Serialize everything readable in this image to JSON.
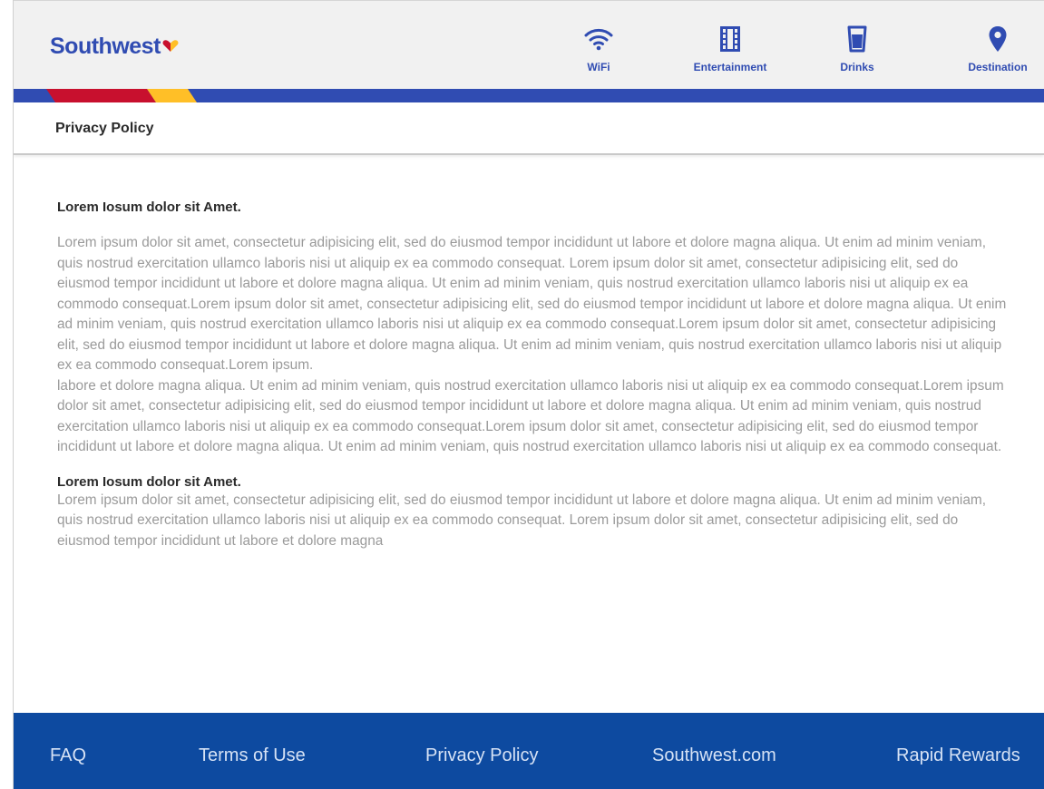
{
  "header": {
    "brand": "Southwest",
    "nav": [
      {
        "label": "WiFi",
        "icon": "wifi-icon"
      },
      {
        "label": "Entertainment",
        "icon": "film-icon"
      },
      {
        "label": "Drinks",
        "icon": "drink-icon"
      },
      {
        "label": "Destination",
        "icon": "map-pin-icon"
      }
    ],
    "colors": {
      "brand_blue": "#304cb2",
      "stripe_red": "#c8102e",
      "stripe_yellow": "#ffbf27"
    }
  },
  "page": {
    "title": "Privacy Policy"
  },
  "content": {
    "section1": {
      "heading": "Lorem Iosum dolor sit Amet.",
      "paragraph1": "Lorem ipsum dolor sit amet, consectetur adipisicing elit, sed do eiusmod tempor incididunt ut labore et dolore magna aliqua. Ut enim ad minim veniam, quis nostrud exercitation ullamco laboris nisi ut aliquip ex ea commodo consequat. Lorem ipsum dolor sit amet, consectetur adipisicing elit, sed do eiusmod tempor incididunt ut labore et dolore magna aliqua. Ut enim ad minim veniam, quis nostrud exercitation ullamco laboris nisi ut aliquip ex ea commodo consequat.Lorem ipsum dolor sit amet, consectetur adipisicing elit, sed do eiusmod tempor incididunt ut labore et dolore magna aliqua. Ut enim ad minim veniam, quis nostrud exercitation ullamco laboris nisi ut aliquip ex ea commodo consequat.Lorem ipsum dolor sit amet, consectetur adipisicing elit, sed do eiusmod tempor incididunt ut labore et dolore magna aliqua. Ut enim ad minim veniam, quis nostrud exercitation ullamco laboris nisi ut aliquip ex ea commodo consequat.Lorem ipsum.",
      "paragraph2": "labore et dolore magna aliqua. Ut enim ad minim veniam, quis nostrud exercitation ullamco laboris nisi ut aliquip ex ea commodo consequat.Lorem ipsum dolor sit amet, consectetur adipisicing elit, sed do eiusmod tempor incididunt ut labore et dolore magna aliqua. Ut enim ad minim veniam, quis nostrud exercitation ullamco laboris nisi ut aliquip ex ea commodo consequat.Lorem ipsum dolor sit amet, consectetur adipisicing elit, sed do eiusmod tempor incididunt ut labore et dolore magna aliqua. Ut enim ad minim veniam, quis nostrud exercitation ullamco laboris nisi ut aliquip ex ea commodo consequat."
    },
    "section2": {
      "heading": "Lorem Iosum dolor sit Amet.",
      "paragraph": "Lorem ipsum dolor sit amet, consectetur adipisicing elit, sed do eiusmod tempor incididunt ut labore et dolore magna aliqua. Ut enim ad minim veniam, quis nostrud exercitation ullamco laboris nisi ut aliquip ex ea commodo consequat. Lorem ipsum dolor sit amet, consectetur adipisicing elit, sed do eiusmod tempor incididunt ut labore et dolore magna"
    }
  },
  "footer": {
    "links": [
      "FAQ",
      "Terms of Use",
      "Privacy Policy",
      "Southwest.com",
      "Rapid Rewards"
    ],
    "background": "#0d4aa0"
  }
}
